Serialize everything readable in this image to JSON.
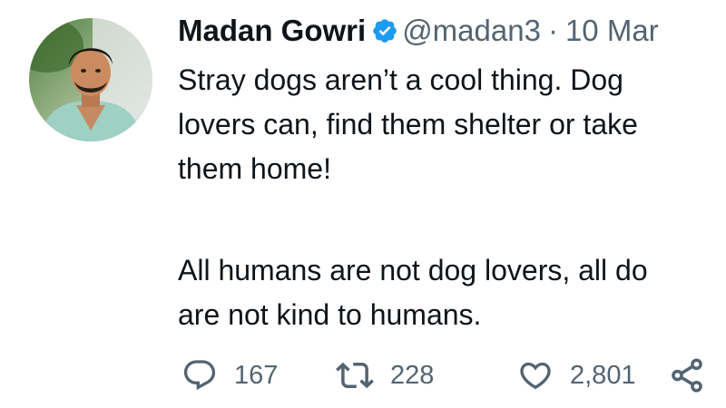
{
  "tweet": {
    "author": {
      "display_name": "Madan Gowri",
      "handle": "@madan3",
      "verified": true
    },
    "separator": "·",
    "date": "10 Mar",
    "body_lines": [
      "Stray dogs aren’t a cool thing.  Dog",
      "lovers can, find them shelter or take",
      "them home!",
      "All humans are not dog lovers, all do",
      "are not kind to humans."
    ],
    "metrics": {
      "replies": "167",
      "retweets": "228",
      "likes": "2,801"
    },
    "icons": {
      "verified": "verified-badge-icon",
      "reply": "reply-icon",
      "retweet": "retweet-icon",
      "like": "heart-icon",
      "share": "share-icon"
    },
    "colors": {
      "text": "#0f1419",
      "muted": "#536471",
      "verified": "#1d9bf0",
      "background": "#ffffff"
    }
  }
}
